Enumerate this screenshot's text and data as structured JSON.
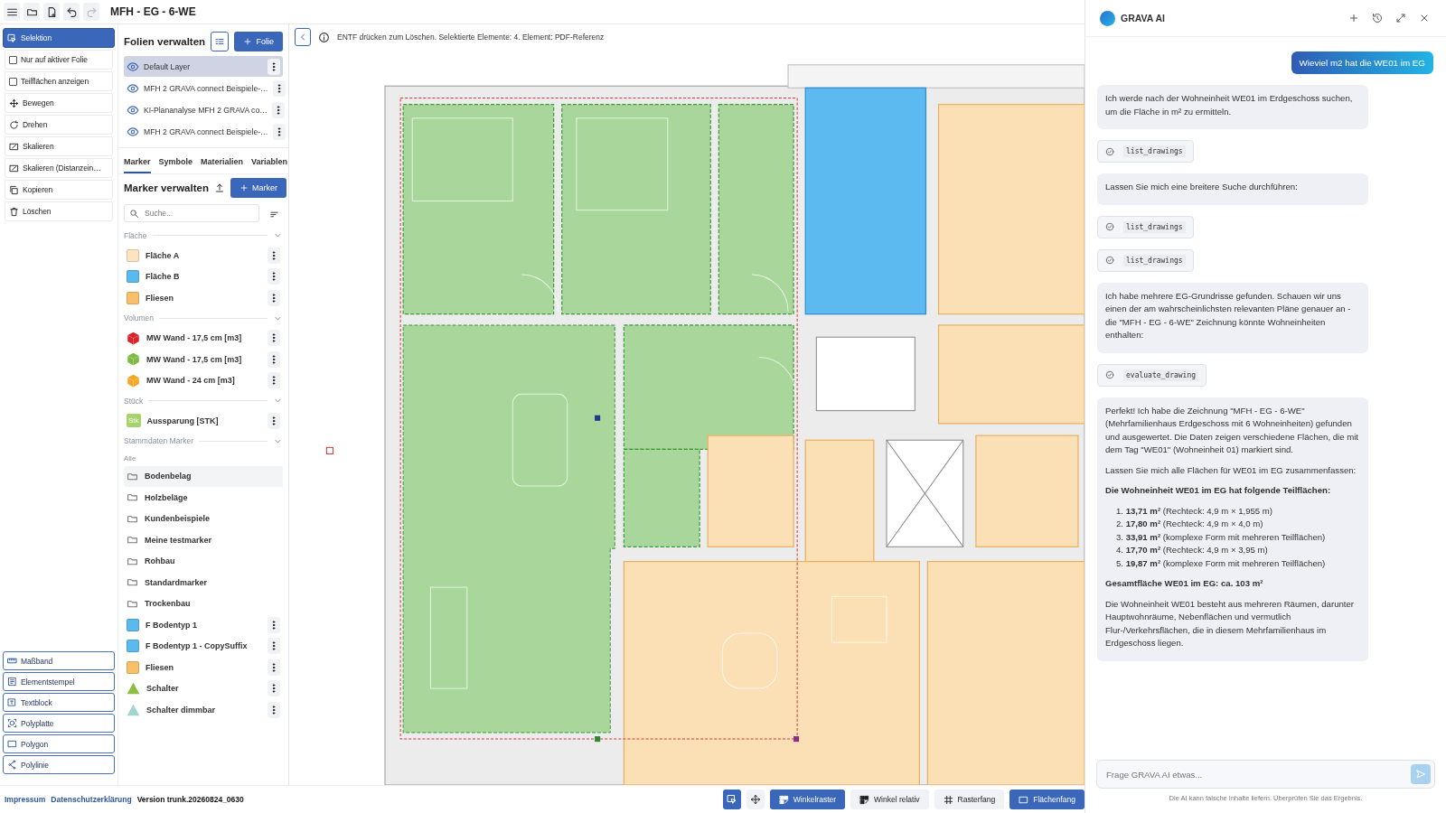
{
  "document": {
    "title": "MFH - EG - 6-WE"
  },
  "tools": [
    {
      "kind": "tool",
      "label": "Selektion",
      "selected": true
    },
    {
      "kind": "checkbox",
      "label": "Nur auf aktiver Folie",
      "checked": false
    },
    {
      "kind": "checkbox",
      "label": "Teilflächen anzeigen",
      "checked": false
    },
    {
      "kind": "tool",
      "label": "Bewegen",
      "selected": false
    },
    {
      "kind": "tool",
      "label": "Drehen",
      "selected": false
    },
    {
      "kind": "tool",
      "label": "Skalieren",
      "selected": false
    },
    {
      "kind": "tool",
      "label": "Skalieren (Distanzein…",
      "selected": false
    },
    {
      "kind": "tool",
      "label": "Kopieren",
      "selected": false
    },
    {
      "kind": "tool",
      "label": "Löschen",
      "selected": false
    }
  ],
  "drawing_tools": [
    "Maßband",
    "Elementstempel",
    "Textblock",
    "Polyplatte",
    "Polygon",
    "Polylinie"
  ],
  "layers_panel": {
    "title": "Folien verwalten",
    "add_button": "Folie",
    "layers": [
      {
        "name": "Default Layer",
        "selected": true
      },
      {
        "name": "MFH 2 GRAVA connect Beispiele-…",
        "selected": false
      },
      {
        "name": "KI-Plananalyse MFH 2 GRAVA co…",
        "selected": false
      },
      {
        "name": "MFH 2 GRAVA connect Beispiele-…",
        "selected": false
      }
    ]
  },
  "tabs": [
    {
      "label": "Marker",
      "selected": true
    },
    {
      "label": "Symbole",
      "selected": false
    },
    {
      "label": "Materialien",
      "selected": false
    },
    {
      "label": "Variablen",
      "selected": false
    }
  ],
  "marker_panel": {
    "title": "Marker verwalten",
    "add_button": "Marker",
    "search": {
      "placeholder": "Suche..."
    },
    "groups": [
      {
        "title": "Fläche",
        "items": [
          {
            "kind": "swatch",
            "name": "Fläche A",
            "color": "#fde3bf"
          },
          {
            "kind": "swatch",
            "name": "Fläche B",
            "color": "#5bb9ee"
          },
          {
            "kind": "swatch",
            "name": "Fliesen",
            "color": "#f9c06a"
          }
        ]
      },
      {
        "title": "Volumen",
        "items": [
          {
            "kind": "cube",
            "name": "MW Wand - 17,5 cm [m3]",
            "color": "#d9222a"
          },
          {
            "kind": "cube",
            "name": "MW Wand - 17,5 cm [m3]",
            "color": "#7dbb42"
          },
          {
            "kind": "cube",
            "name": "MW Wand - 24 cm [m3]",
            "color": "#f5a623"
          }
        ]
      },
      {
        "title": "Stück",
        "items": [
          {
            "kind": "badge",
            "name": "Aussparung [STK]",
            "color": "#a6d36b",
            "badge": "Stk"
          }
        ]
      }
    ],
    "master": {
      "title": "Stammdaten Marker",
      "filter": "Alle",
      "folders": [
        {
          "name": "Bodenbelag",
          "selected": true
        },
        {
          "name": "Holzbeläge",
          "selected": false
        },
        {
          "name": "Kundenbeispiele",
          "selected": false
        },
        {
          "name": "Meine testmarker",
          "selected": false
        },
        {
          "name": "Rohbau",
          "selected": false
        },
        {
          "name": "Standardmarker",
          "selected": false
        },
        {
          "name": "Trockenbau",
          "selected": false
        }
      ],
      "items": [
        {
          "kind": "swatch",
          "name": "F Bodentyp 1",
          "color": "#5bb9ee"
        },
        {
          "kind": "swatch",
          "name": "F Bodentyp 1 - CopySuffix",
          "color": "#5bb9ee"
        },
        {
          "kind": "swatch",
          "name": "Fliesen",
          "color": "#f9c06a"
        },
        {
          "kind": "triangle",
          "name": "Schalter",
          "color": "#8cbf3f"
        },
        {
          "kind": "triangle",
          "name": "Schalter dimmbar",
          "color": "#9fd6cf"
        }
      ]
    }
  },
  "info_bar": {
    "message": "ENTF drücken zum Löschen. Selektierte Elemente: 4. Element: PDF-Referenz"
  },
  "footer": {
    "links": [
      "Impressum",
      "Datenschutzerklärung"
    ],
    "version": "Version trunk.20260824_0630"
  },
  "snap_icon_buttons": [
    {
      "selected": true
    },
    {
      "selected": false
    }
  ],
  "snap_buttons": [
    {
      "label": "Winkelraster",
      "selected": true
    },
    {
      "label": "Winkel relativ",
      "selected": false
    },
    {
      "label": "Rasterfang",
      "selected": false
    },
    {
      "label": "Flächenfang",
      "selected": true
    }
  ],
  "chat": {
    "title": "GRAVA AI",
    "messages": [
      {
        "kind": "user",
        "text": "Wieviel m2 hat die WE01 im EG"
      },
      {
        "kind": "assistant",
        "blocks": [
          {
            "kind": "p",
            "text": "Ich werde nach der Wohneinheit WE01 im Erdgeschoss suchen, um die Fläche in m² zu ermitteln."
          }
        ]
      },
      {
        "kind": "tool",
        "text": "list_drawings"
      },
      {
        "kind": "assistant",
        "blocks": [
          {
            "kind": "p",
            "text": "Lassen Sie mich eine breitere Suche durchführen:"
          }
        ]
      },
      {
        "kind": "tool",
        "text": "list_drawings"
      },
      {
        "kind": "tool",
        "text": "list_drawings"
      },
      {
        "kind": "assistant",
        "blocks": [
          {
            "kind": "p",
            "text": "Ich habe mehrere EG-Grundrisse gefunden. Schauen wir uns einen der am wahrscheinlichsten relevanten Pläne genauer an - die \"MFH - EG - 6-WE\" Zeichnung könnte Wohneinheiten enthalten:"
          }
        ]
      },
      {
        "kind": "tool",
        "text": "evaluate_drawing"
      },
      {
        "kind": "assistant",
        "blocks": [
          {
            "kind": "p",
            "text": "Perfekt! Ich habe die Zeichnung \"MFH - EG - 6-WE\" (Mehrfamilienhaus Erdgeschoss mit 6 Wohneinheiten) gefunden und ausgewertet. Die Daten zeigen verschiedene Flächen, die mit dem Tag \"WE01\" (Wohneinheit 01) markiert sind."
          },
          {
            "kind": "p",
            "text": "Lassen Sie mich alle Flächen für WE01 im EG zusammenfassen:"
          },
          {
            "kind": "heading",
            "text": "Die Wohneinheit WE01 im EG hat folgende Teilflächen:"
          },
          {
            "kind": "list",
            "items": [
              "1. **13,71 m²** (Rechteck: 4,9 m × 1,955 m)",
              "2. **17,80 m²** (Rechteck: 4,9 m × 4,0 m)",
              "3. **33,91 m²** (komplexe Form mit mehreren Teilflächen)",
              "4. **17,70 m²** (Rechteck: 4,9 m × 3,95 m)",
              "5. **19,87 m²** (komplexe Form mit mehreren Teilflächen)"
            ]
          },
          {
            "kind": "heading",
            "text": "Gesamtfläche WE01 im EG: ca. 103 m²"
          },
          {
            "kind": "p",
            "text": "Die Wohneinheit WE01 besteht aus mehreren Räumen, darunter Hauptwohnräume, Nebenflächen und vermutlich Flur-/Verkehrsflächen, die in diesem Mehrfamilienhaus im Erdgeschoss liegen."
          }
        ]
      }
    ],
    "input": {
      "placeholder": "Frage GRAVA AI etwas..."
    },
    "disclaimer": "Die AI kann falsche Inhalte liefern. Überprüfen Sie das Ergebnis."
  }
}
